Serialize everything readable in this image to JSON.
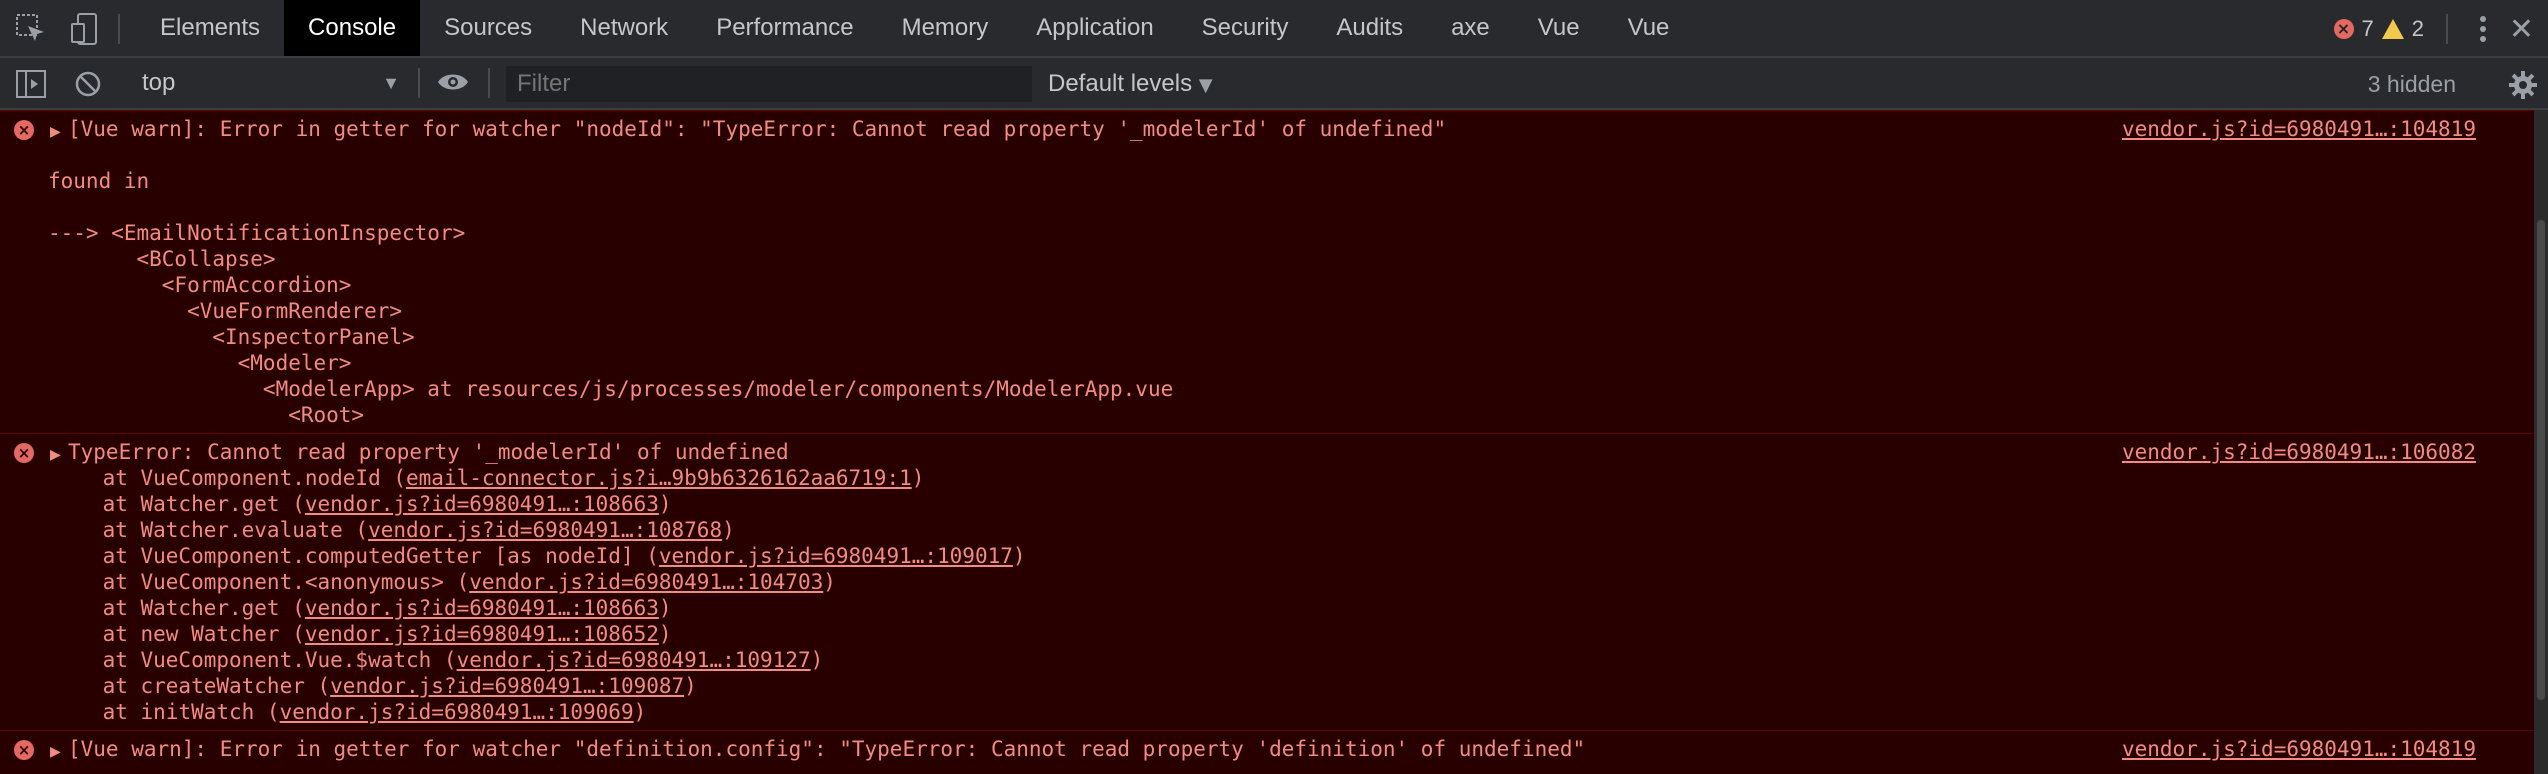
{
  "tabs": [
    "Elements",
    "Console",
    "Sources",
    "Network",
    "Performance",
    "Memory",
    "Application",
    "Security",
    "Audits",
    "axe",
    "Vue",
    "Vue"
  ],
  "counts": {
    "errors": "7",
    "warnings": "2"
  },
  "toolbar": {
    "context": "top",
    "filter_placeholder": "Filter",
    "levels": "Default levels",
    "hidden": "3 hidden"
  },
  "messages": {
    "m1": {
      "head": "[Vue warn]: Error in getter for watcher \"nodeId\": \"TypeError: Cannot read property '_modelerId' of undefined\"",
      "src": "vendor.js?id=6980491…:104819",
      "found": "found in",
      "tree": [
        "---> <EmailNotificationInspector>",
        "       <BCollapse>",
        "         <FormAccordion>",
        "           <VueFormRenderer>",
        "             <InspectorPanel>",
        "               <Modeler>",
        "                 <ModelerApp> at resources/js/processes/modeler/components/ModelerApp.vue",
        "                   <Root>"
      ]
    },
    "m2": {
      "head": "TypeError: Cannot read property '_modelerId' of undefined",
      "src": "vendor.js?id=6980491…:106082",
      "stack": [
        {
          "pre": "    at VueComponent.nodeId (",
          "link": "email-connector.js?i…9b9b6326162aa6719:1",
          "post": ")"
        },
        {
          "pre": "    at Watcher.get (",
          "link": "vendor.js?id=6980491…:108663",
          "post": ")"
        },
        {
          "pre": "    at Watcher.evaluate (",
          "link": "vendor.js?id=6980491…:108768",
          "post": ")"
        },
        {
          "pre": "    at VueComponent.computedGetter [as nodeId] (",
          "link": "vendor.js?id=6980491…:109017",
          "post": ")"
        },
        {
          "pre": "    at VueComponent.<anonymous> (",
          "link": "vendor.js?id=6980491…:104703",
          "post": ")"
        },
        {
          "pre": "    at Watcher.get (",
          "link": "vendor.js?id=6980491…:108663",
          "post": ")"
        },
        {
          "pre": "    at new Watcher (",
          "link": "vendor.js?id=6980491…:108652",
          "post": ")"
        },
        {
          "pre": "    at VueComponent.Vue.$watch (",
          "link": "vendor.js?id=6980491…:109127",
          "post": ")"
        },
        {
          "pre": "    at createWatcher (",
          "link": "vendor.js?id=6980491…:109087",
          "post": ")"
        },
        {
          "pre": "    at initWatch (",
          "link": "vendor.js?id=6980491…:109069",
          "post": ")"
        }
      ]
    },
    "m3": {
      "head": "[Vue warn]: Error in getter for watcher \"definition.config\": \"TypeError: Cannot read property 'definition' of undefined\"",
      "src": "vendor.js?id=6980491…:104819"
    }
  },
  "icons": {
    "inspect": "inspect-element-icon",
    "device": "device-toolbar-icon",
    "sidebar": "console-sidebar-icon",
    "clear": "clear-console-icon",
    "eye": "live-expression-icon",
    "gear": "settings-gear-icon"
  },
  "colors": {
    "error_bg": "#290000",
    "error_text": "#f28b82",
    "error_icon": "#e46962",
    "warn": "#f2c94c"
  }
}
